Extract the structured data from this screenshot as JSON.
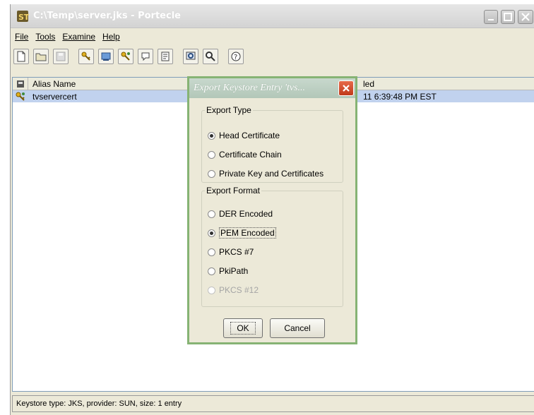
{
  "window": {
    "title": "C:\\Temp\\server.jks - Portecle"
  },
  "menu": [
    "File",
    "Tools",
    "Examine",
    "Help"
  ],
  "toolbar": {
    "icons": [
      "new-keystore-icon",
      "open-keystore-icon",
      "save-keystore-icon",
      "generate-keypair-icon",
      "import-trusted-cert-icon",
      "import-keypair-icon",
      "set-password-icon",
      "keystore-report-icon",
      "examine-certificate-icon",
      "examine-crl-icon",
      "help-icon"
    ]
  },
  "table": {
    "columns": [
      "Alias Name",
      "led"
    ],
    "rows": [
      {
        "alias": "tvservercert",
        "date": "11 6:39:48 PM EST"
      }
    ]
  },
  "status": "Keystore type: JKS, provider: SUN, size: 1 entry",
  "dialog": {
    "title": "Export Keystore Entry 'tvs...",
    "export_type": {
      "legend": "Export Type",
      "options": [
        "Head Certificate",
        "Certificate Chain",
        "Private Key and Certificates"
      ],
      "selected": "Head Certificate"
    },
    "export_format": {
      "legend": "Export Format",
      "options": [
        "DER Encoded",
        "PEM Encoded",
        "PKCS #7",
        "PkiPath",
        "PKCS #12"
      ],
      "selected": "PEM Encoded",
      "disabled": [
        "PKCS #12"
      ]
    },
    "ok_label": "OK",
    "cancel_label": "Cancel"
  },
  "colors": {
    "selection": "#c1d2ee",
    "dialog_border": "#86b374",
    "close_button": "#d04a2a"
  }
}
